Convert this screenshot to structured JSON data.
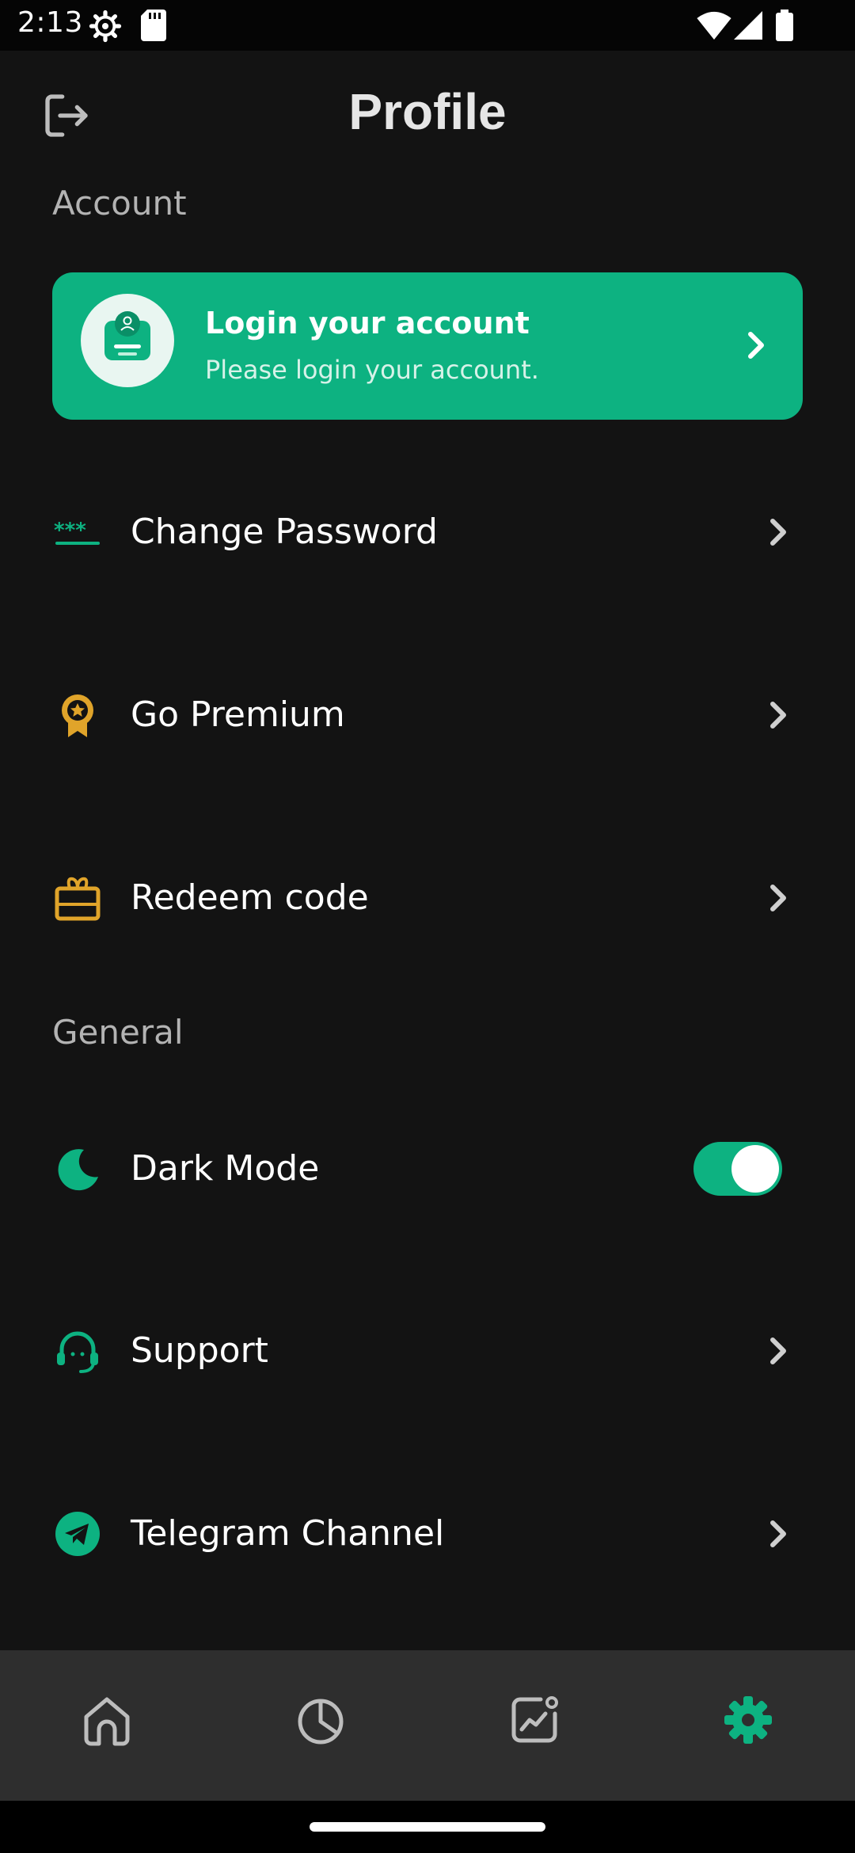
{
  "status_bar": {
    "time": "2:13"
  },
  "header": {
    "title": "Profile"
  },
  "sections": {
    "account": "Account",
    "general": "General"
  },
  "login_card": {
    "title": "Login your account",
    "subtitle": "Please login your account."
  },
  "menu": {
    "change_password": "Change Password",
    "go_premium": "Go Premium",
    "redeem_code": "Redeem code",
    "dark_mode": "Dark Mode",
    "support": "Support",
    "telegram_channel": "Telegram Channel"
  },
  "dark_mode_enabled": true,
  "colors": {
    "accent": "#0db281",
    "background": "#131313",
    "premium": "#e0a42a",
    "nav_bar": "#2e2e2e"
  },
  "bottom_nav": {
    "items": [
      "home-icon",
      "pie-chart-icon",
      "analytics-icon",
      "settings-icon"
    ],
    "active": "settings-icon"
  }
}
